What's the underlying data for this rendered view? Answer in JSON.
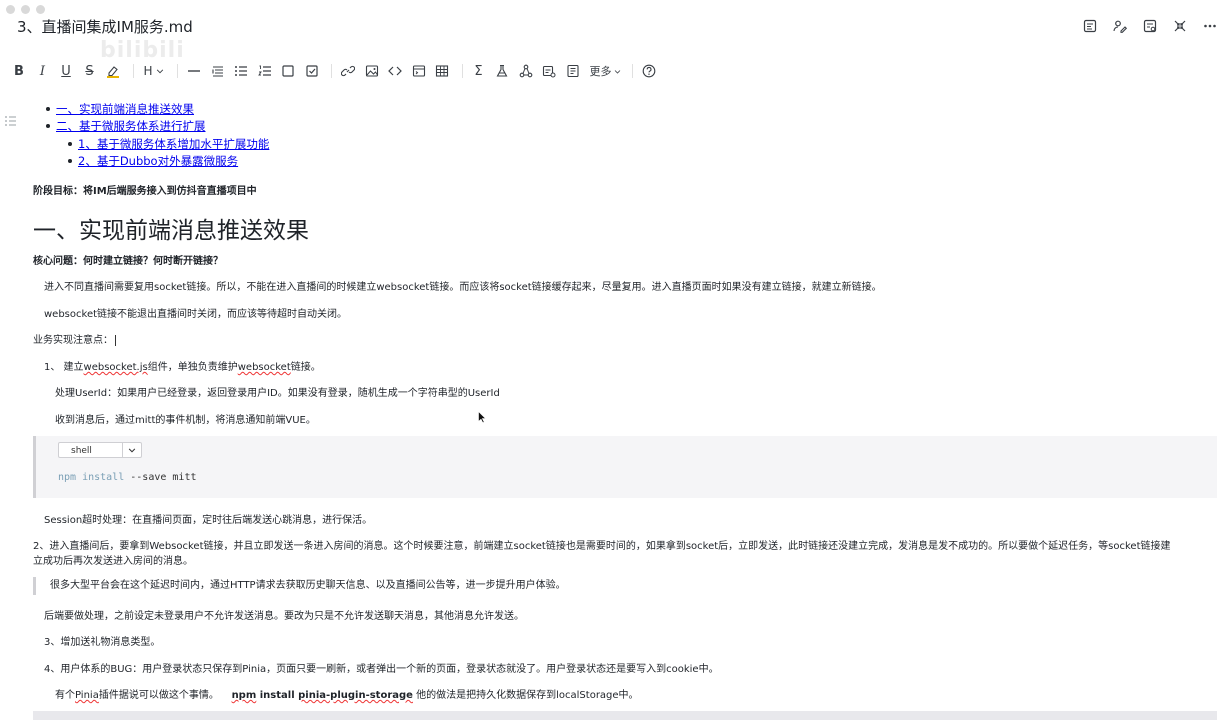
{
  "window": {
    "title": "3、直播间集成IM服务.md",
    "watermark": "bilibili"
  },
  "title_actions": [
    "outline-icon",
    "edit-user-icon",
    "settings-list-icon",
    "collapse-icon",
    "more-icon"
  ],
  "toolbar": {
    "items": [
      "B",
      "I",
      "U",
      "S",
      "highlight",
      "H",
      "hr",
      "blockquote",
      "bullet-list",
      "ordered-list",
      "square",
      "checkbox",
      "link",
      "image",
      "code",
      "code-block",
      "table",
      "sigma",
      "flask",
      "diagram",
      "attach",
      "note"
    ],
    "more_label": "更多",
    "help": "?"
  },
  "toc": [
    {
      "label": "一、实现前端消息推送效果",
      "level": 1
    },
    {
      "label": "二、基于微服务体系进行扩展",
      "level": 1
    },
    {
      "label": "1、基于微服务体系增加水平扩展功能",
      "level": 2
    },
    {
      "label": "2、基于Dubbo对外暴露微服务",
      "level": 2
    }
  ],
  "stage_goal": "阶段目标：将IM后端服务接入到仿抖音直播项目中",
  "heading1": "一、实现前端消息推送效果",
  "core_question": "核心问题：何时建立链接？何时断开链接？",
  "p1": "进入不同直播间需要复用socket链接。所以，不能在进入直播间的时候建立websocket链接。而应该将socket链接缓存起来，尽量复用。进入直播页面时如果没有建立链接，就建立新链接。",
  "p2": "websocket链接不能退出直播间时关闭，而应该等待超时自动关闭。",
  "p3": "业务实现注意点：",
  "p4_prefix": "1、 建立",
  "p4_w1": "websocket.js",
  "p4_mid": "组件，单独负责维护",
  "p4_w2": "websocket",
  "p4_suffix": "链接。",
  "p5": "处理UserId：如果用户已经登录，返回登录用户ID。如果没有登录，随机生成一个字符串型的UserId",
  "p6": "收到消息后，通过mitt的事件机制，将消息通知前端VUE。",
  "code": {
    "language": "shell",
    "line_kw": "npm install",
    "line_rest": " --save mitt"
  },
  "p7": "Session超时处理：在直播间页面，定时往后端发送心跳消息，进行保活。",
  "p8a": "2、进入直播间后，要拿到Websocket链接，并且立即发送一条进入房间的消息。这个时候要注意，前端建立socket链接也是需要时间的，如果拿到socket后，立即发送，此时链接还没建立完成，发消息是发不成功的。所以要做个延迟任务，等socket链接建",
  "p8b": "立成功后再次发送进入房间的消息。",
  "quote": "很多大型平台会在这个延迟时间内，通过HTTP请求去获取历史聊天信息、以及直播间公告等，进一步提升用户体验。",
  "p9": "后端要做处理，之前设定未登录用户不允许发送消息。要改为只是不允许发送聊天消息，其他消息允许发送。",
  "p10": "3、增加送礼物消息类型。",
  "p11": "4、用户体系的BUG：用户登录状态只保存到Pinia，页面只要一刷新，或者弹出一个新的页面，登录状态就没了。用户登录状态还是要写入到cookie中。",
  "p12_a": "有个",
  "p12_w1": "Pinia",
  "p12_b": "插件据说可以做这个事情。",
  "p12_cmd1": "npm",
  "p12_cmd2": " install ",
  "p12_cmd3": "pinia-plugin-storage",
  "p12_c": " 他的做法是把持久化数据保存到localStorage中。"
}
